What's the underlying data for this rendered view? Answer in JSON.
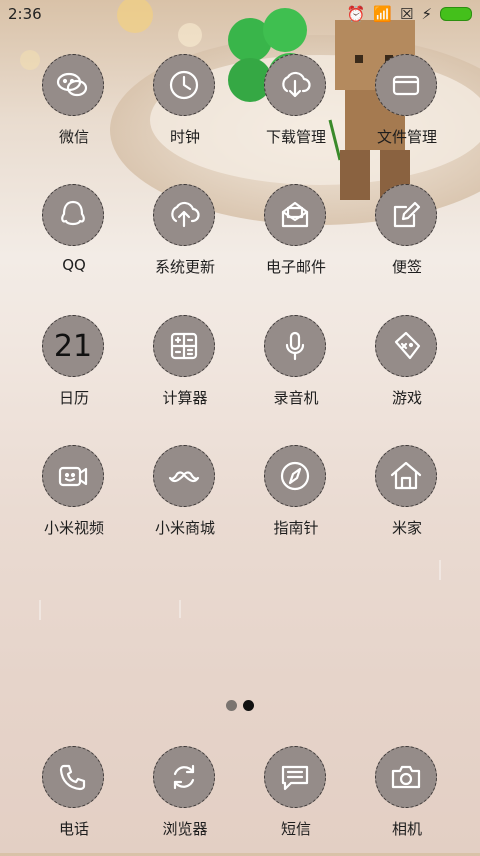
{
  "status": {
    "time": "2:36"
  },
  "apps": [
    {
      "label": "微信",
      "icon": "wechat-icon"
    },
    {
      "label": "时钟",
      "icon": "clock-icon"
    },
    {
      "label": "下载管理",
      "icon": "download-cloud-icon"
    },
    {
      "label": "文件管理",
      "icon": "file-card-icon"
    },
    {
      "label": "QQ",
      "icon": "qq-penguin-icon"
    },
    {
      "label": "系统更新",
      "icon": "upload-cloud-icon"
    },
    {
      "label": "电子邮件",
      "icon": "mail-icon"
    },
    {
      "label": "便签",
      "icon": "note-pen-icon"
    },
    {
      "label": "日历",
      "icon": "calendar-icon",
      "date": "21"
    },
    {
      "label": "计算器",
      "icon": "calculator-icon"
    },
    {
      "label": "录音机",
      "icon": "microphone-icon"
    },
    {
      "label": "游戏",
      "icon": "gamepad-icon"
    },
    {
      "label": "小米视频",
      "icon": "video-camera-icon"
    },
    {
      "label": "小米商城",
      "icon": "mustache-icon"
    },
    {
      "label": "指南针",
      "icon": "compass-icon"
    },
    {
      "label": "米家",
      "icon": "home-icon"
    }
  ],
  "page_indicator": {
    "count": 2,
    "active": 2
  },
  "dock": [
    {
      "label": "电话",
      "icon": "phone-icon"
    },
    {
      "label": "浏览器",
      "icon": "refresh-icon"
    },
    {
      "label": "短信",
      "icon": "message-icon"
    },
    {
      "label": "相机",
      "icon": "camera-icon"
    }
  ],
  "colors": {
    "icon_bg": "#958c89",
    "battery": "#44c01b"
  }
}
